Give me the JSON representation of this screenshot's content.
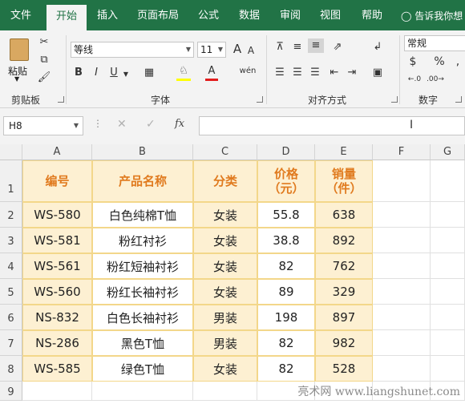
{
  "tabs": [
    "文件",
    "开始",
    "插入",
    "页面布局",
    "公式",
    "数据",
    "审阅",
    "视图",
    "帮助"
  ],
  "active_tab": "开始",
  "tell_me": "告诉我你想",
  "ribbon": {
    "paste_label": "粘贴",
    "font_name": "等线",
    "font_size": "11",
    "number_format": "常规",
    "bold": "B",
    "italic": "I",
    "underline": "U",
    "increase_font": "A",
    "decrease_font": "A",
    "font_color_letter": "A",
    "wen": "wén",
    "currency": "$",
    "percent": "%",
    "comma": ",",
    "groups": {
      "clipboard": "剪贴板",
      "font": "字体",
      "alignment": "对齐方式",
      "number": "数字"
    }
  },
  "formula_bar": {
    "name_box": "H8",
    "fx": "fx",
    "value": ""
  },
  "columns": [
    "A",
    "B",
    "C",
    "D",
    "E",
    "F",
    "G"
  ],
  "rows": [
    "1",
    "2",
    "3",
    "4",
    "5",
    "6",
    "7",
    "8",
    "9"
  ],
  "table": {
    "headers": [
      {
        "l1": "编号",
        "l2": ""
      },
      {
        "l1": "产品名称",
        "l2": ""
      },
      {
        "l1": "分类",
        "l2": ""
      },
      {
        "l1": "价格",
        "l2": "（元）"
      },
      {
        "l1": "销量",
        "l2": "（件）"
      }
    ],
    "rows": [
      [
        "WS-580",
        "白色纯棉T恤",
        "女装",
        "55.8",
        "638"
      ],
      [
        "WS-581",
        "粉红衬衫",
        "女装",
        "38.8",
        "892"
      ],
      [
        "WS-561",
        "粉红短袖衬衫",
        "女装",
        "82",
        "762"
      ],
      [
        "WS-560",
        "粉红长袖衬衫",
        "女装",
        "89",
        "329"
      ],
      [
        "NS-832",
        "白色长袖衬衫",
        "男装",
        "198",
        "897"
      ],
      [
        "NS-286",
        "黑色T恤",
        "男装",
        "82",
        "982"
      ],
      [
        "WS-585",
        "绿色T恤",
        "女装",
        "82",
        "528"
      ]
    ]
  },
  "watermark": "亮术网 www.liangshunet.com",
  "colors": {
    "ribbon_green": "#217346",
    "header_orange": "#e07a1e",
    "fill_light": "#fdf0d2",
    "border_gold": "#f3d78a"
  }
}
